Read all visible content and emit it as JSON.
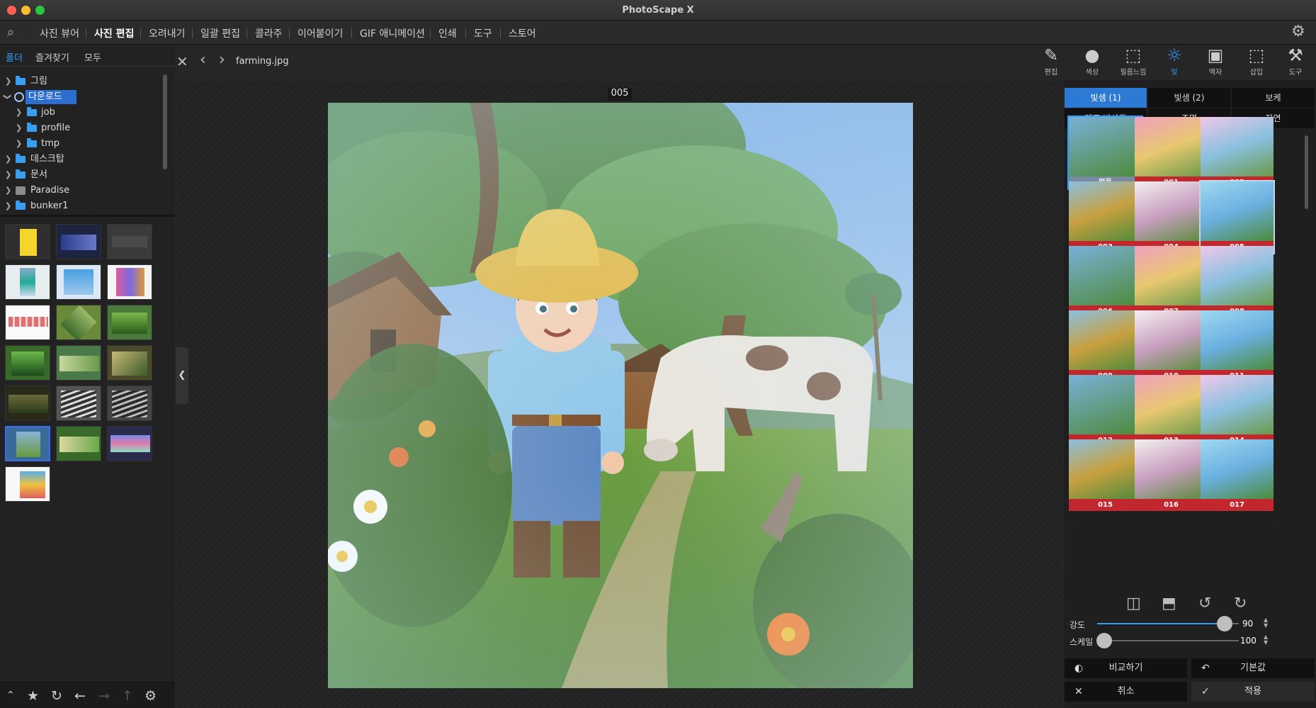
{
  "app": {
    "title": "PhotoScape X"
  },
  "menu": {
    "items": [
      "사진 뷰어",
      "사진 편집",
      "오려내기",
      "일괄 편집",
      "콜라주",
      "이어붙이기",
      "GIF 애니메이션",
      "인쇄",
      "도구",
      "스토어"
    ],
    "active": "사진 편집"
  },
  "browser": {
    "tabs": [
      "폴더",
      "즐겨찾기",
      "모두"
    ],
    "tree": [
      {
        "label": "그림",
        "expanded": false
      },
      {
        "label": "다운로드",
        "expanded": true,
        "selected": true
      },
      {
        "label": "job"
      },
      {
        "label": "profile"
      },
      {
        "label": "tmp"
      },
      {
        "label": "데스크탑"
      },
      {
        "label": "문서"
      },
      {
        "label": "Paradise"
      },
      {
        "label": "bunker1"
      }
    ]
  },
  "editor": {
    "filename": "farming.jpg",
    "current_filter": "005"
  },
  "toolbar": {
    "items": [
      {
        "label": "편집",
        "icon": "pencil-square-icon"
      },
      {
        "label": "색상",
        "icon": "circle-icon"
      },
      {
        "label": "필름느낌",
        "icon": "film-icon"
      },
      {
        "label": "빛",
        "icon": "sun-icon",
        "active": true
      },
      {
        "label": "액자",
        "icon": "frame-icon"
      },
      {
        "label": "삽입",
        "icon": "insert-icon"
      },
      {
        "label": "도구",
        "icon": "tools-icon"
      }
    ]
  },
  "filters": {
    "categories": [
      "빛샘 (1)",
      "빛샘 (2)",
      "보케",
      "렌즈 반사광",
      "조명",
      "자연"
    ],
    "active_category": "빛샘 (1)",
    "thumbs": [
      "없음",
      "001",
      "002",
      "003",
      "004",
      "005",
      "006",
      "007",
      "008",
      "009",
      "010",
      "011",
      "012",
      "013",
      "014",
      "015",
      "016",
      "017"
    ],
    "selected": "005"
  },
  "adjust": {
    "strength_label": "강도",
    "strength_value": "90",
    "strength_fraction": 0.9,
    "scale_label": "스케일",
    "scale_value": "100",
    "scale_fraction": 0.0
  },
  "buttons": {
    "compare": "비교하기",
    "default": "기본값",
    "cancel": "취소",
    "apply": "적용"
  },
  "colors": {
    "accent": "#2f9bff",
    "filter_label": "#c1272d"
  }
}
